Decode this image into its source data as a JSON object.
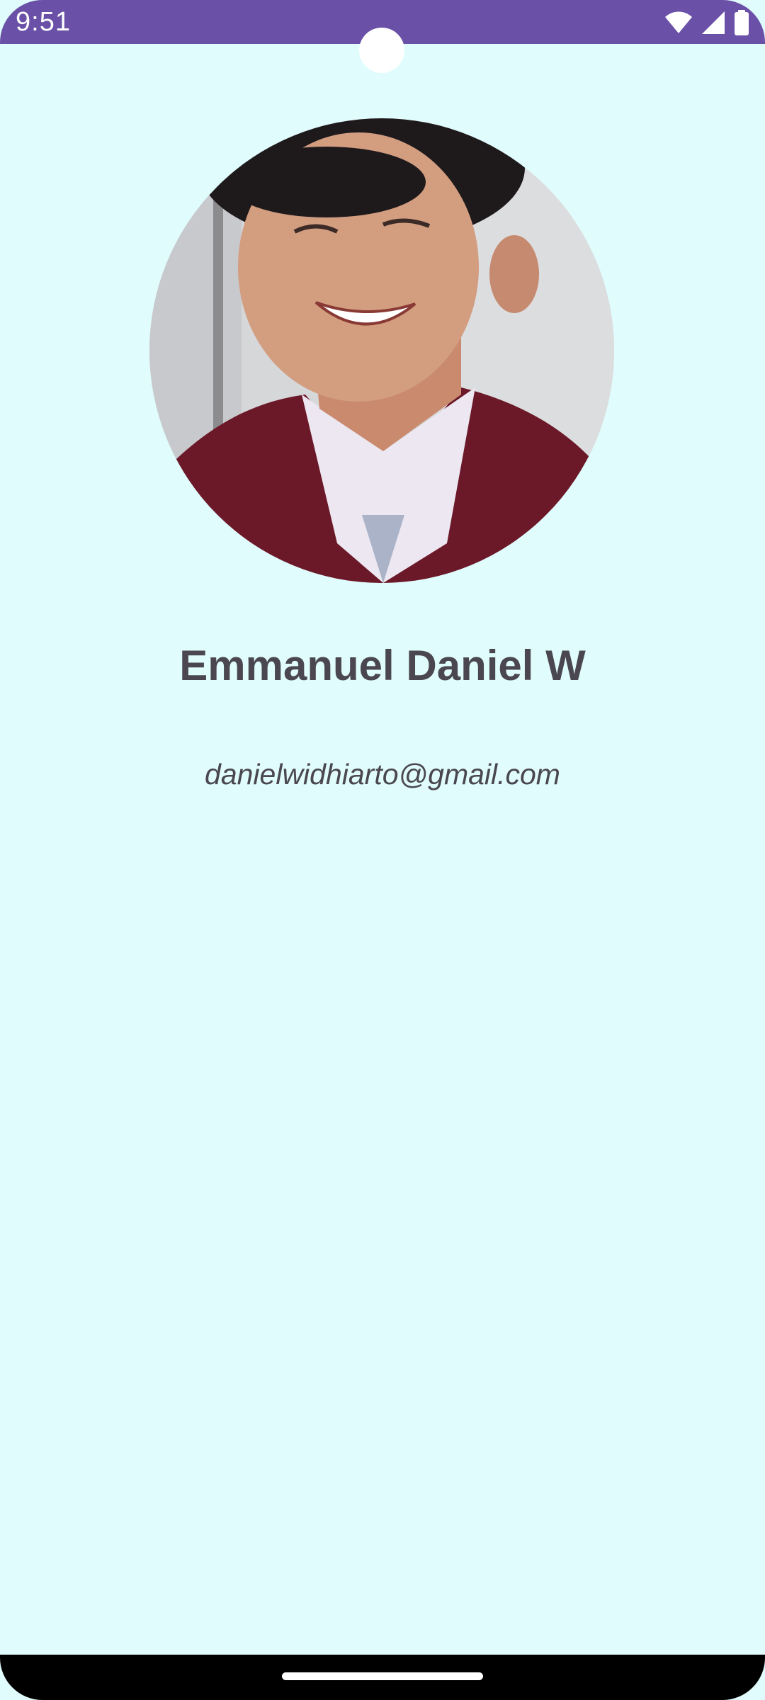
{
  "status_bar": {
    "time": "9:51",
    "background_color": "#6a50a7",
    "icons": [
      "wifi-icon",
      "cellular-signal-icon",
      "battery-icon"
    ]
  },
  "profile": {
    "avatar_icon": "profile-photo",
    "name": "Emmanuel Daniel W",
    "email": "danielwidhiarto@gmail.com"
  },
  "theme": {
    "background": "#e0fcfc",
    "text_color": "#4a4751"
  },
  "navigation_bar": {
    "icons": [
      "home-handle"
    ]
  }
}
